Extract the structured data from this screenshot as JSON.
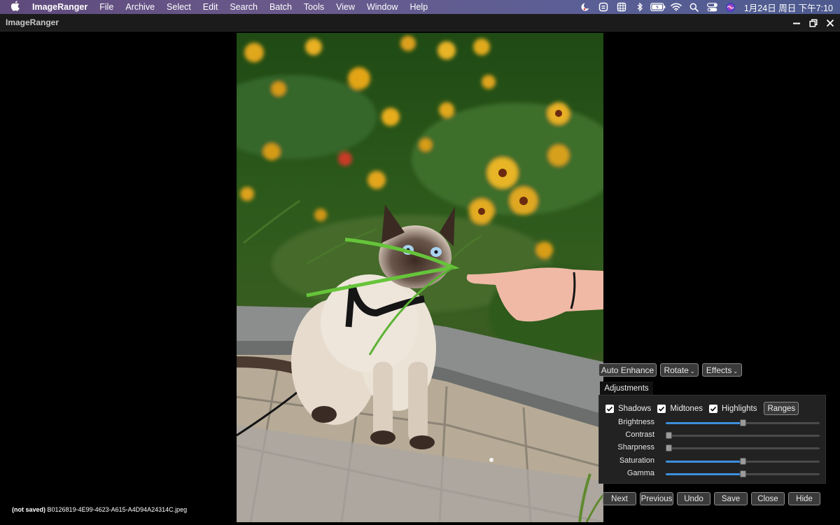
{
  "menubar": {
    "app_name": "ImageRanger",
    "items": [
      "File",
      "Archive",
      "Select",
      "Edit",
      "Search",
      "Batch",
      "Tools",
      "View",
      "Window",
      "Help"
    ],
    "clock": "1月24日 周日 下午7:10"
  },
  "window": {
    "title": "ImageRanger"
  },
  "status": {
    "prefix": "(not saved)",
    "filename": "B0126819-4E99-4623-A615-A4D94A24314C.jpeg"
  },
  "toolbar": {
    "auto_enhance": "Auto Enhance",
    "rotate": "Rotate",
    "effects": "Effects"
  },
  "adjustments": {
    "tab_label": "Adjustments",
    "checks": [
      {
        "label": "Shadows",
        "checked": true
      },
      {
        "label": "Midtones",
        "checked": true
      },
      {
        "label": "Highlights",
        "checked": true
      }
    ],
    "ranges_label": "Ranges",
    "sliders": [
      {
        "label": "Brightness",
        "value": 0.5
      },
      {
        "label": "Contrast",
        "value": 0.0
      },
      {
        "label": "Sharpness",
        "value": 0.0
      },
      {
        "label": "Saturation",
        "value": 0.5
      },
      {
        "label": "Gamma",
        "value": 0.5
      }
    ]
  },
  "actions": {
    "next": "Next",
    "previous": "Previous",
    "undo": "Undo",
    "save": "Save",
    "close": "Close",
    "hide": "Hide"
  },
  "colors": {
    "accent": "#3c8fdc"
  }
}
